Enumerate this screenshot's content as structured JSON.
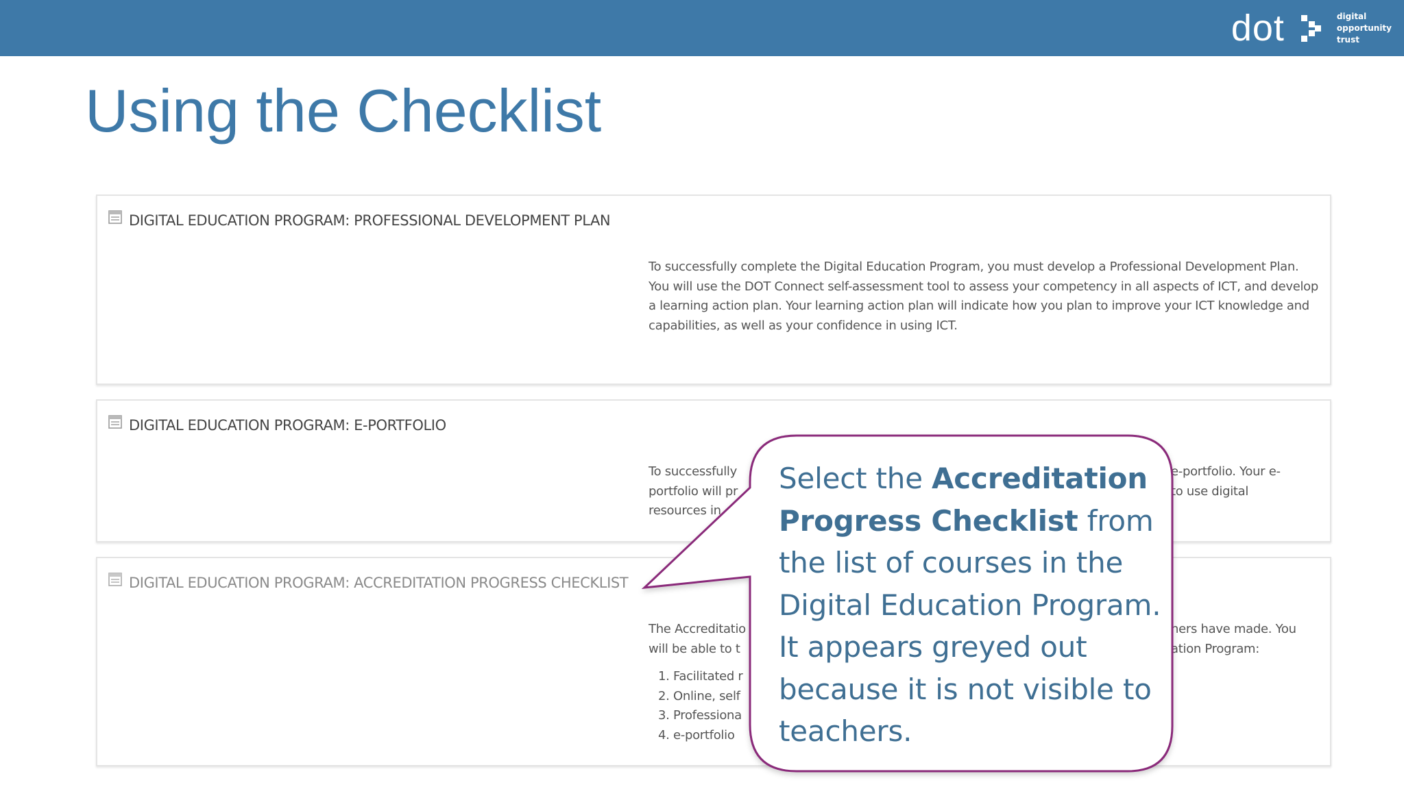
{
  "header": {
    "logo_word": "dot",
    "logo_lines": [
      "digital",
      "opportunity",
      "trust"
    ],
    "bar_color": "#3e79a8"
  },
  "slide": {
    "title": "Using the Checklist"
  },
  "courses": [
    {
      "title": "DIGITAL EDUCATION PROGRAM: PROFESSIONAL DEVELOPMENT PLAN",
      "description": "To successfully complete the Digital Education Program, you must develop a Professional Development Plan. You will use the DOT Connect self-assessment tool to assess your competency in all aspects of ICT, and develop a learning action plan. Your learning action plan will indicate how you plan to improve your ICT knowledge and capabilities, as well as your confidence in using ICT."
    },
    {
      "title": "DIGITAL EDUCATION PROGRAM: E-PORTFOLIO",
      "description_line1_start": "To successfully",
      "description_line1_end": "e-portfolio. Your e-",
      "description_line2_start": "portfolio will pr",
      "description_line2_end": "to use digital",
      "description_line3_start": "resources in"
    },
    {
      "title": "DIGITAL EDUCATION PROGRAM: ACCREDITATION PROGRESS CHECKLIST",
      "status": "greyed out",
      "description_line1_start": "The Accreditatio",
      "description_line1_end": "hers have made. You",
      "description_line2_start": "will be able to t",
      "description_line2_end": "ation Program:",
      "list": [
        "Facilitated r",
        "Online, self",
        "Professiona",
        "e-portfolio"
      ]
    }
  ],
  "callout": {
    "text_1": "Select the ",
    "bold_1": "Accreditation Progress Checklist",
    "text_2": " from the list of courses in the Digital Education Program. It appears greyed out because it is not visible to teachers.",
    "border_color": "#8a2a7a",
    "text_color": "#3f6f93"
  }
}
